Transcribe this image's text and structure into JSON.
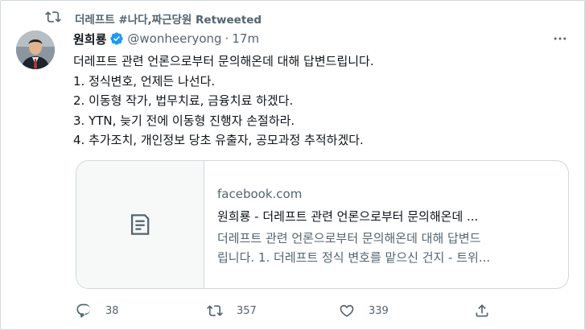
{
  "retweet_context": {
    "text": "더레프트 #나다,짜근당원 Retweeted"
  },
  "tweet": {
    "author_name": "원희룡",
    "handle": "@wonheeryong",
    "separator": "·",
    "time": "17m",
    "lines": [
      "더레프트 관련 언론으로부터 문의해온데 대해 답변드립니다.",
      "1. 정식변호, 언제든 나선다.",
      "2. 이동형 작가, 법무치료, 금융치료 하겠다.",
      "3. YTN, 늦기 전에 이동형 진행자 손절하라.",
      "4. 추가조치, 개인정보 당초 유출자, 공모과정 추적하겠다."
    ]
  },
  "card": {
    "domain": "facebook.com",
    "title": "원희룡 - 더레프트 관련 언론으로부터 문의해온데 ...",
    "desc_lines": [
      "더레프트 관련 언론으로부터 문의해온데 대해 답변드",
      "립니다. 1. 더레프트 정식 변호를 맡으신 건지 - 트위..."
    ]
  },
  "actions": {
    "reply_count": "38",
    "retweet_count": "357",
    "like_count": "339"
  },
  "icons": {
    "retweet": "retweet-icon",
    "verified": "verified-badge-icon",
    "more": "more-icon",
    "card_thumb": "document-icon",
    "reply": "reply-icon",
    "like": "heart-icon",
    "share": "share-icon"
  },
  "colors": {
    "text_primary": "#0f1419",
    "text_secondary": "#536471",
    "verified_blue": "#1d9bf0",
    "border": "#cfd9de"
  }
}
